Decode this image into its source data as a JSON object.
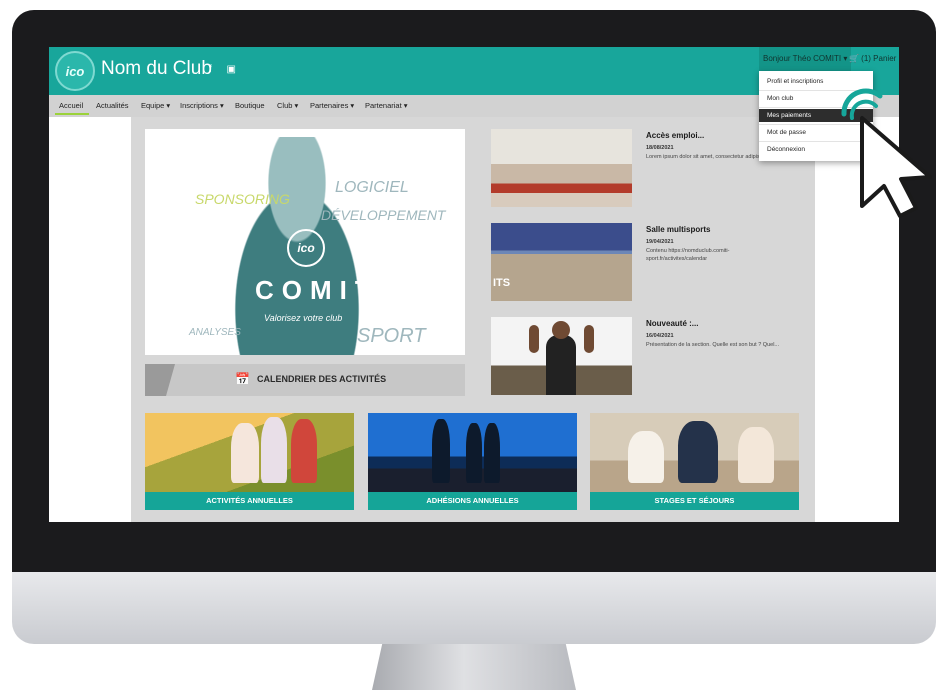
{
  "header": {
    "club_name": "Nom du Club",
    "social_icons": "f ▣",
    "logo_text": "ico",
    "greeting": "Bonjour Théo COMITI ▾",
    "cart": "🛒 (1) Panier"
  },
  "nav": {
    "items": [
      "Accueil",
      "Actualités",
      "Equipe ▾",
      "Inscriptions ▾",
      "Boutique",
      "Club ▾",
      "Partenaires ▾",
      "Partenariat ▾"
    ]
  },
  "dropdown": {
    "items": [
      "Profil et inscriptions",
      "Mon club",
      "Mes paiements",
      "Mot de passe",
      "Déconnexion"
    ],
    "active_index": 2
  },
  "hero": {
    "words": [
      "SPONSORING",
      "LOGICIEL",
      "DÉVELOPPEMENT",
      "ANALYSES",
      "SPORT"
    ],
    "badge": "ico",
    "title": "COMITI",
    "slogan": "Valorisez votre club"
  },
  "calendar": {
    "label": "CALENDRIER DES ACTIVITÉS",
    "icon": "calendar-icon"
  },
  "news": [
    {
      "title": "Accès emploi...",
      "date": "18/08/2021",
      "text": "Lorem ipsum dolor sit amet, consectetur adipiscing..."
    },
    {
      "title": "Salle multisports",
      "date": "19/04/2021",
      "text": "Contenu https://nomduclub.comiti-sport.fr/activites/calendar"
    },
    {
      "title": "Nouveauté :...",
      "date": "16/04/2021",
      "text": "Présentation de la section. Quelle est son but ? Quel..."
    }
  ],
  "hall_overlay": "ITS",
  "cards": [
    "ACTIVITÉS ANNUELLES",
    "ADHÉSIONS ANNUELLES",
    "STAGES ET SÉJOURS"
  ],
  "colors": {
    "brand": "#18a69b",
    "nav_active": "#9bd23a"
  }
}
